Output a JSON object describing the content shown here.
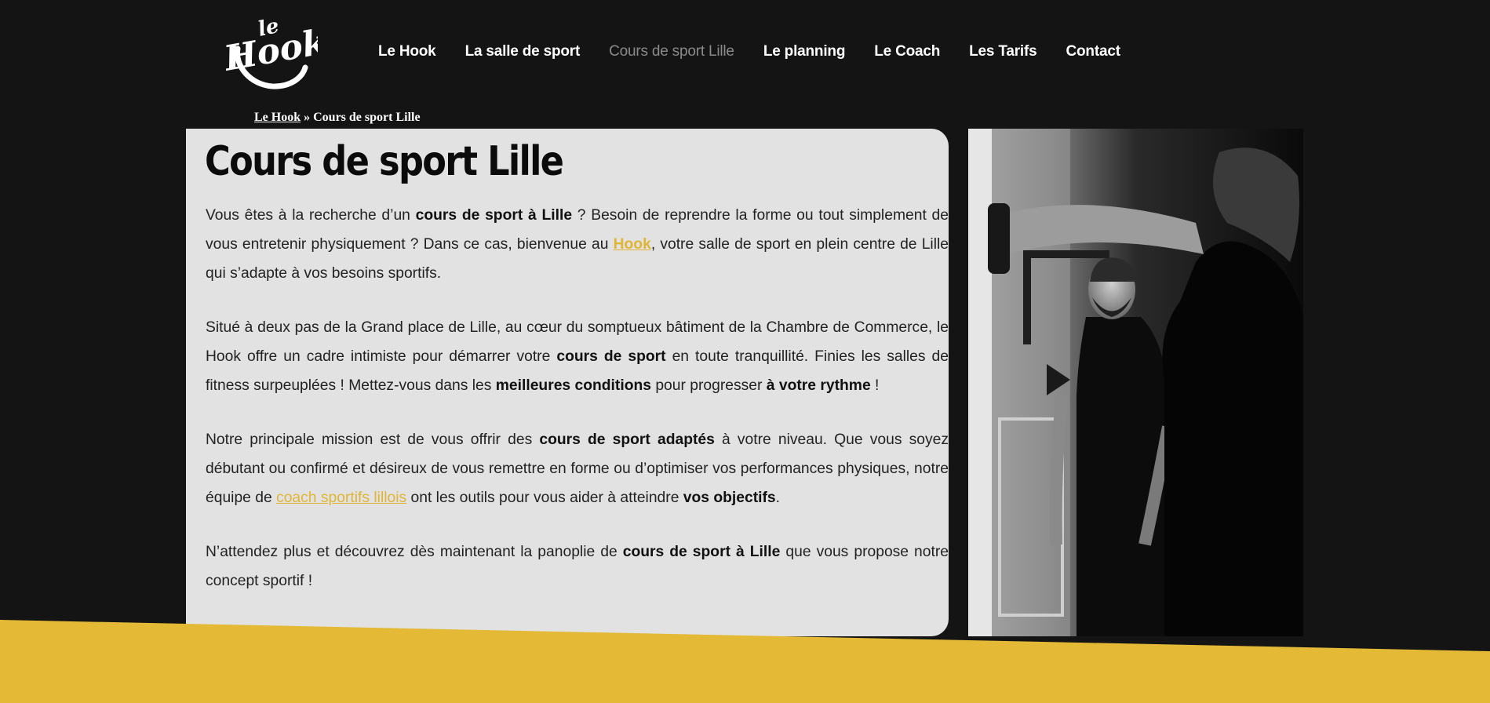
{
  "logo": {
    "text_top": "le",
    "text_main": "Hook"
  },
  "nav": {
    "items": [
      {
        "label": "Le Hook"
      },
      {
        "label": "La salle de sport"
      },
      {
        "label": "Cours de sport Lille",
        "active": true
      },
      {
        "label": "Le planning"
      },
      {
        "label": "Le Coach"
      },
      {
        "label": "Les Tarifs"
      },
      {
        "label": "Contact"
      }
    ]
  },
  "breadcrumb": {
    "home": "Le Hook",
    "separator": " » ",
    "current": "Cours de sport Lille"
  },
  "main": {
    "title": "Cours de sport Lille",
    "p1": {
      "a": "Vous êtes à la recherche d’un ",
      "b1": "cours de sport à Lille",
      "c": " ? Besoin de reprendre la forme ou tout simplement de vous entretenir physiquement ? Dans ce cas, bienvenue au ",
      "link": "Hook",
      "d": ", votre salle de sport en plein centre de Lille qui s’adapte à vos besoins sportifs."
    },
    "p2": {
      "a": "Situé à deux pas de la Grand place de Lille, au cœur du somptueux bâtiment de la Chambre de Commerce, le Hook offre un cadre intimiste pour démarrer votre ",
      "b1": "cours de sport",
      "c": " en toute tranquillité. Finies les salles de fitness surpeuplées ! Mettez-vous dans les ",
      "b2": "meilleures conditions",
      "d": " pour progresser ",
      "b3": "à votre rythme",
      "e": " !"
    },
    "p3": {
      "a": "Notre principale mission est de vous offrir des ",
      "b1": "cours de sport adaptés",
      "c": " à votre niveau. Que vous soyez débutant ou confirmé et désireux de vous remettre en forme ou d’optimiser vos performances physiques, notre équipe de ",
      "link": "coach sportifs lillois",
      "d": " ont les outils pour vous aider à atteindre ",
      "b2": "vos objectifs",
      "e": "."
    },
    "p4": {
      "a": "N’attendez plus et découvrez dès maintenant la panoplie de ",
      "b1": "cours de sport à Lille",
      "c": " que vous propose notre concept sportif !"
    }
  },
  "colors": {
    "background": "#141414",
    "card": "#e2e2e2",
    "accent": "#e3b935"
  },
  "photo": {
    "icon": "boxing-coach-photo"
  }
}
